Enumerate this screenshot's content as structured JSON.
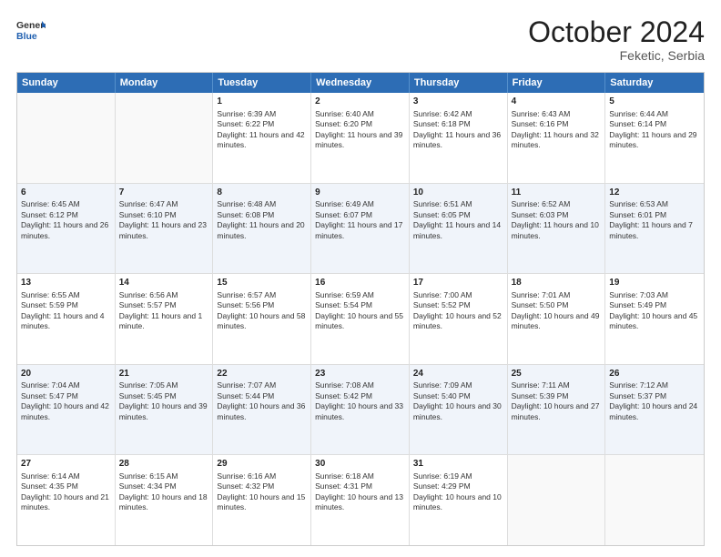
{
  "header": {
    "logo": {
      "line1": "General",
      "line2": "Blue"
    },
    "month": "October 2024",
    "location": "Feketic, Serbia"
  },
  "days_of_week": [
    "Sunday",
    "Monday",
    "Tuesday",
    "Wednesday",
    "Thursday",
    "Friday",
    "Saturday"
  ],
  "weeks": [
    [
      {
        "day": "",
        "empty": true
      },
      {
        "day": "",
        "empty": true
      },
      {
        "day": "1",
        "sunrise": "6:39 AM",
        "sunset": "6:22 PM",
        "daylight": "11 hours and 42 minutes."
      },
      {
        "day": "2",
        "sunrise": "6:40 AM",
        "sunset": "6:20 PM",
        "daylight": "11 hours and 39 minutes."
      },
      {
        "day": "3",
        "sunrise": "6:42 AM",
        "sunset": "6:18 PM",
        "daylight": "11 hours and 36 minutes."
      },
      {
        "day": "4",
        "sunrise": "6:43 AM",
        "sunset": "6:16 PM",
        "daylight": "11 hours and 32 minutes."
      },
      {
        "day": "5",
        "sunrise": "6:44 AM",
        "sunset": "6:14 PM",
        "daylight": "11 hours and 29 minutes."
      }
    ],
    [
      {
        "day": "6",
        "sunrise": "6:45 AM",
        "sunset": "6:12 PM",
        "daylight": "11 hours and 26 minutes."
      },
      {
        "day": "7",
        "sunrise": "6:47 AM",
        "sunset": "6:10 PM",
        "daylight": "11 hours and 23 minutes."
      },
      {
        "day": "8",
        "sunrise": "6:48 AM",
        "sunset": "6:08 PM",
        "daylight": "11 hours and 20 minutes."
      },
      {
        "day": "9",
        "sunrise": "6:49 AM",
        "sunset": "6:07 PM",
        "daylight": "11 hours and 17 minutes."
      },
      {
        "day": "10",
        "sunrise": "6:51 AM",
        "sunset": "6:05 PM",
        "daylight": "11 hours and 14 minutes."
      },
      {
        "day": "11",
        "sunrise": "6:52 AM",
        "sunset": "6:03 PM",
        "daylight": "11 hours and 10 minutes."
      },
      {
        "day": "12",
        "sunrise": "6:53 AM",
        "sunset": "6:01 PM",
        "daylight": "11 hours and 7 minutes."
      }
    ],
    [
      {
        "day": "13",
        "sunrise": "6:55 AM",
        "sunset": "5:59 PM",
        "daylight": "11 hours and 4 minutes."
      },
      {
        "day": "14",
        "sunrise": "6:56 AM",
        "sunset": "5:57 PM",
        "daylight": "11 hours and 1 minute."
      },
      {
        "day": "15",
        "sunrise": "6:57 AM",
        "sunset": "5:56 PM",
        "daylight": "10 hours and 58 minutes."
      },
      {
        "day": "16",
        "sunrise": "6:59 AM",
        "sunset": "5:54 PM",
        "daylight": "10 hours and 55 minutes."
      },
      {
        "day": "17",
        "sunrise": "7:00 AM",
        "sunset": "5:52 PM",
        "daylight": "10 hours and 52 minutes."
      },
      {
        "day": "18",
        "sunrise": "7:01 AM",
        "sunset": "5:50 PM",
        "daylight": "10 hours and 49 minutes."
      },
      {
        "day": "19",
        "sunrise": "7:03 AM",
        "sunset": "5:49 PM",
        "daylight": "10 hours and 45 minutes."
      }
    ],
    [
      {
        "day": "20",
        "sunrise": "7:04 AM",
        "sunset": "5:47 PM",
        "daylight": "10 hours and 42 minutes."
      },
      {
        "day": "21",
        "sunrise": "7:05 AM",
        "sunset": "5:45 PM",
        "daylight": "10 hours and 39 minutes."
      },
      {
        "day": "22",
        "sunrise": "7:07 AM",
        "sunset": "5:44 PM",
        "daylight": "10 hours and 36 minutes."
      },
      {
        "day": "23",
        "sunrise": "7:08 AM",
        "sunset": "5:42 PM",
        "daylight": "10 hours and 33 minutes."
      },
      {
        "day": "24",
        "sunrise": "7:09 AM",
        "sunset": "5:40 PM",
        "daylight": "10 hours and 30 minutes."
      },
      {
        "day": "25",
        "sunrise": "7:11 AM",
        "sunset": "5:39 PM",
        "daylight": "10 hours and 27 minutes."
      },
      {
        "day": "26",
        "sunrise": "7:12 AM",
        "sunset": "5:37 PM",
        "daylight": "10 hours and 24 minutes."
      }
    ],
    [
      {
        "day": "27",
        "sunrise": "6:14 AM",
        "sunset": "4:35 PM",
        "daylight": "10 hours and 21 minutes."
      },
      {
        "day": "28",
        "sunrise": "6:15 AM",
        "sunset": "4:34 PM",
        "daylight": "10 hours and 18 minutes."
      },
      {
        "day": "29",
        "sunrise": "6:16 AM",
        "sunset": "4:32 PM",
        "daylight": "10 hours and 15 minutes."
      },
      {
        "day": "30",
        "sunrise": "6:18 AM",
        "sunset": "4:31 PM",
        "daylight": "10 hours and 13 minutes."
      },
      {
        "day": "31",
        "sunrise": "6:19 AM",
        "sunset": "4:29 PM",
        "daylight": "10 hours and 10 minutes."
      },
      {
        "day": "",
        "empty": true
      },
      {
        "day": "",
        "empty": true
      }
    ]
  ]
}
